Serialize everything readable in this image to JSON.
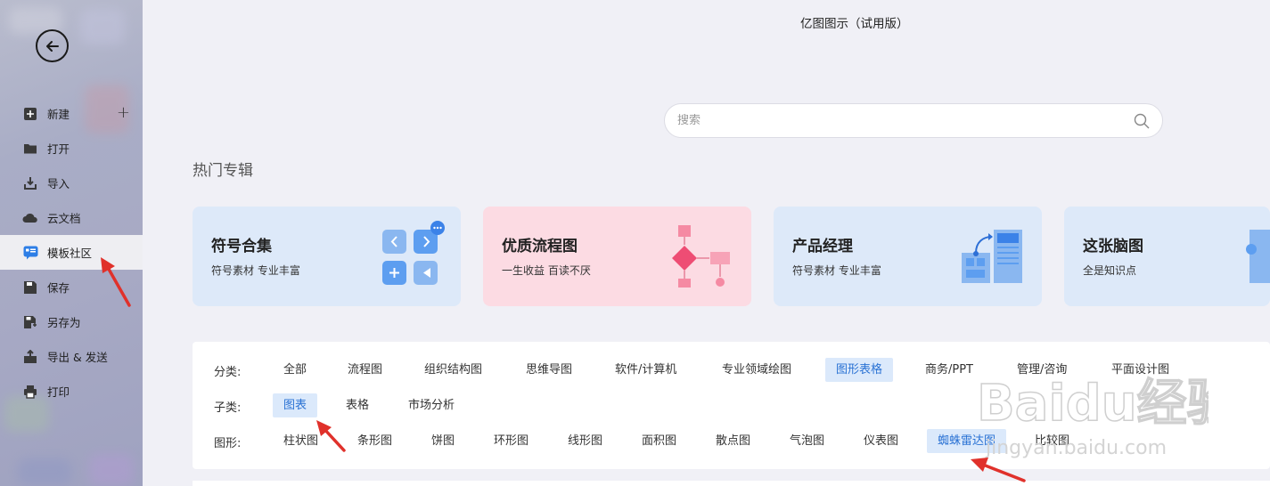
{
  "app": {
    "title": "亿图图示（试用版）"
  },
  "sidebar": {
    "items": [
      {
        "label": "新建",
        "icon": "new-plus-icon"
      },
      {
        "label": "打开",
        "icon": "folder-icon"
      },
      {
        "label": "导入",
        "icon": "import-icon"
      },
      {
        "label": "云文档",
        "icon": "cloud-icon"
      },
      {
        "label": "模板社区",
        "icon": "template-community-icon",
        "active": true
      },
      {
        "label": "保存",
        "icon": "save-icon"
      },
      {
        "label": "另存为",
        "icon": "save-as-icon"
      },
      {
        "label": "导出 & 发送",
        "icon": "export-icon"
      },
      {
        "label": "打印",
        "icon": "print-icon"
      }
    ]
  },
  "search": {
    "placeholder": "搜索"
  },
  "main": {
    "section_title": "热门专辑"
  },
  "cards": [
    {
      "title": "符号合集",
      "subtitle": "符号素材 专业丰富",
      "bg": "#dde9f9"
    },
    {
      "title": "优质流程图",
      "subtitle": "一生收益 百读不厌",
      "bg": "#fcdbe3"
    },
    {
      "title": "产品经理",
      "subtitle": "符号素材 专业丰富",
      "bg": "#dde9f9"
    },
    {
      "title": "这张脑图",
      "subtitle": "全是知识点",
      "bg": "#dde9f9"
    }
  ],
  "filters": {
    "category": {
      "label": "分类:",
      "options": [
        "全部",
        "流程图",
        "组织结构图",
        "思维导图",
        "软件/计算机",
        "专业领域绘图",
        "图形表格",
        "商务/PPT",
        "管理/咨询",
        "平面设计图"
      ],
      "selected": "图形表格"
    },
    "subcategory": {
      "label": "子类:",
      "options": [
        "图表",
        "表格",
        "市场分析"
      ],
      "selected": "图表"
    },
    "shape": {
      "label": "图形:",
      "options": [
        "柱状图",
        "条形图",
        "饼图",
        "环形图",
        "线形图",
        "面积图",
        "散点图",
        "气泡图",
        "仪表图",
        "蜘蛛雷达图",
        "比较图"
      ],
      "selected": "蜘蛛雷达图"
    }
  },
  "colors": {
    "accent": "#2a72d4",
    "selected_bg": "#dbe9fb",
    "annotation_arrow": "#e0312b"
  },
  "watermark": {
    "text": "Baidu经验",
    "url": "jingyan.baidu.com"
  }
}
